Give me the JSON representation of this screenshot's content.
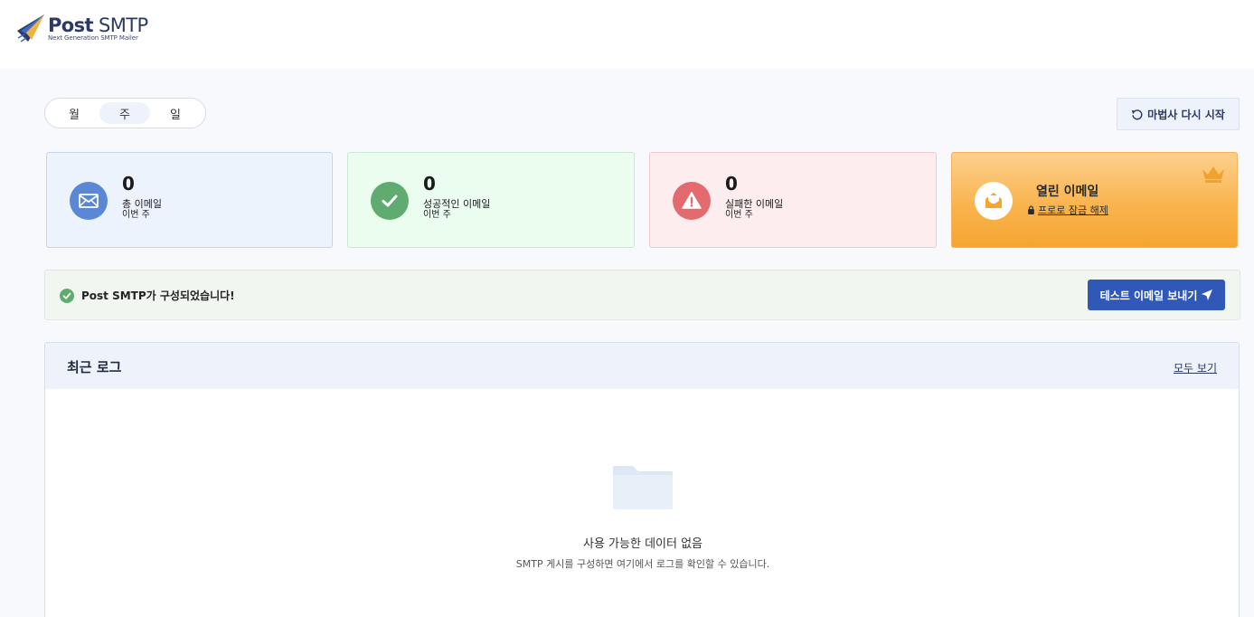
{
  "brand": {
    "name_bold": "Post",
    "name_light": " SMTP",
    "tagline": "Next Generation SMTP Mailer"
  },
  "period_toggle": {
    "options": [
      {
        "label": "월",
        "active": false
      },
      {
        "label": "주",
        "active": true
      },
      {
        "label": "일",
        "active": false
      }
    ]
  },
  "restart_wizard": {
    "label": "마법사 다시 시작",
    "icon": "undo-icon"
  },
  "stats": {
    "total": {
      "value": "0",
      "label": "총 이메일",
      "period": "이번 주",
      "color": "#5b88d6",
      "icon": "envelope-icon"
    },
    "success": {
      "value": "0",
      "label": "성공적인 이메일",
      "period": "이번 주",
      "color": "#60ab6f",
      "icon": "check-icon"
    },
    "failed": {
      "value": "0",
      "label": "실패한 이메일",
      "period": "이번 주",
      "color": "#e36b6f",
      "icon": "warning-icon"
    },
    "opened": {
      "label": "열린 이메일",
      "unlock": "프로로 잠금 해제",
      "icon": "open-envelope-icon",
      "badge_icon": "crown-icon"
    }
  },
  "status": {
    "message": "Post SMTP가 구성되었습니다!",
    "color": "#60ab6f",
    "test_button": "테스트 이메일 보내기"
  },
  "recent_logs": {
    "title": "최근 로그",
    "view_all": "모두 보기",
    "empty_title": "사용 가능한 데이터 없음",
    "empty_subtitle": "SMTP 게시를 구성하면 여기에서 로그를 확인할 수 있습니다."
  },
  "colors": {
    "accent": "#3058b8",
    "brand": "#2c3a63"
  }
}
